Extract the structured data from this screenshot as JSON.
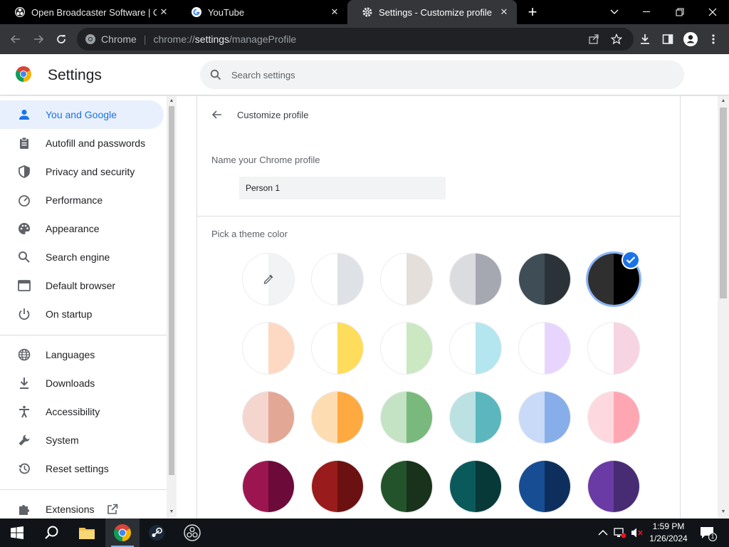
{
  "browser": {
    "tabs": [
      {
        "title": "Open Broadcaster Software | OBS",
        "icon": "obs-icon"
      },
      {
        "title": "YouTube",
        "icon": "google-icon"
      },
      {
        "title": "Settings - Customize profile",
        "icon": "gear-icon"
      }
    ],
    "omnibox": {
      "chip": "Chrome",
      "url_scheme": "chrome://",
      "url_host": "settings",
      "url_path": "/manageProfile"
    }
  },
  "header": {
    "title": "Settings",
    "search_placeholder": "Search settings"
  },
  "sidebar": {
    "items": [
      {
        "label": "You and Google",
        "icon": "person-icon",
        "active": true
      },
      {
        "label": "Autofill and passwords",
        "icon": "clipboard-icon"
      },
      {
        "label": "Privacy and security",
        "icon": "shield-icon"
      },
      {
        "label": "Performance",
        "icon": "speedometer-icon"
      },
      {
        "label": "Appearance",
        "icon": "palette-icon"
      },
      {
        "label": "Search engine",
        "icon": "search-icon"
      },
      {
        "label": "Default browser",
        "icon": "browser-icon"
      },
      {
        "label": "On startup",
        "icon": "power-icon"
      },
      {
        "label": "Languages",
        "icon": "globe-icon"
      },
      {
        "label": "Downloads",
        "icon": "download-icon"
      },
      {
        "label": "Accessibility",
        "icon": "accessibility-icon"
      },
      {
        "label": "System",
        "icon": "wrench-icon"
      },
      {
        "label": "Reset settings",
        "icon": "history-icon"
      },
      {
        "label": "Extensions",
        "icon": "puzzle-icon"
      }
    ]
  },
  "main": {
    "page_title": "Customize profile",
    "name_label": "Name your Chrome profile",
    "name_value": "Person 1",
    "theme_label": "Pick a theme color",
    "swatches": [
      [
        "#ffffff",
        "#f1f3f4"
      ],
      [
        "#ffffff",
        "#dee1e6"
      ],
      [
        "#ffffff",
        "#e4dfdb"
      ],
      [
        "#dadce0",
        "#a5a8b1"
      ],
      [
        "#3f4d57",
        "#2b3338"
      ],
      [
        "#2f2f2f",
        "#000000"
      ],
      [
        "#ffffff",
        "#fdd9c3"
      ],
      [
        "#ffffff",
        "#fedd5c"
      ],
      [
        "#ffffff",
        "#cbe8c2"
      ],
      [
        "#ffffff",
        "#b4e6ef"
      ],
      [
        "#ffffff",
        "#e8d5fd"
      ],
      [
        "#ffffff",
        "#f7d4e2"
      ],
      [
        "#f4d6cf",
        "#e2a795"
      ],
      [
        "#fedcb1",
        "#ffaa40"
      ],
      [
        "#c4e2c4",
        "#7ab97d"
      ],
      [
        "#bbe1e3",
        "#5bb7bd"
      ],
      [
        "#c8daf7",
        "#87aee9"
      ],
      [
        "#fdd9df",
        "#fea7b3"
      ],
      [
        "#9c1550",
        "#6c0a39"
      ],
      [
        "#9a1b1b",
        "#6c1111"
      ],
      [
        "#23532a",
        "#18321c"
      ],
      [
        "#0a5a5b",
        "#073939"
      ],
      [
        "#174d93",
        "#0e2f5e"
      ],
      [
        "#6a3aa5",
        "#472c74"
      ]
    ],
    "selected_swatch": 5
  },
  "taskbar": {
    "icons": [
      "windows-start-icon",
      "search-icon",
      "file-explorer-icon",
      "chrome-icon",
      "steam-icon",
      "obs-icon"
    ],
    "time": "1:59 PM",
    "date": "1/26/2024",
    "notification_count": "1"
  },
  "colors": {
    "accent": "#1a73e8",
    "active_nav_bg": "#e8f0fe"
  }
}
